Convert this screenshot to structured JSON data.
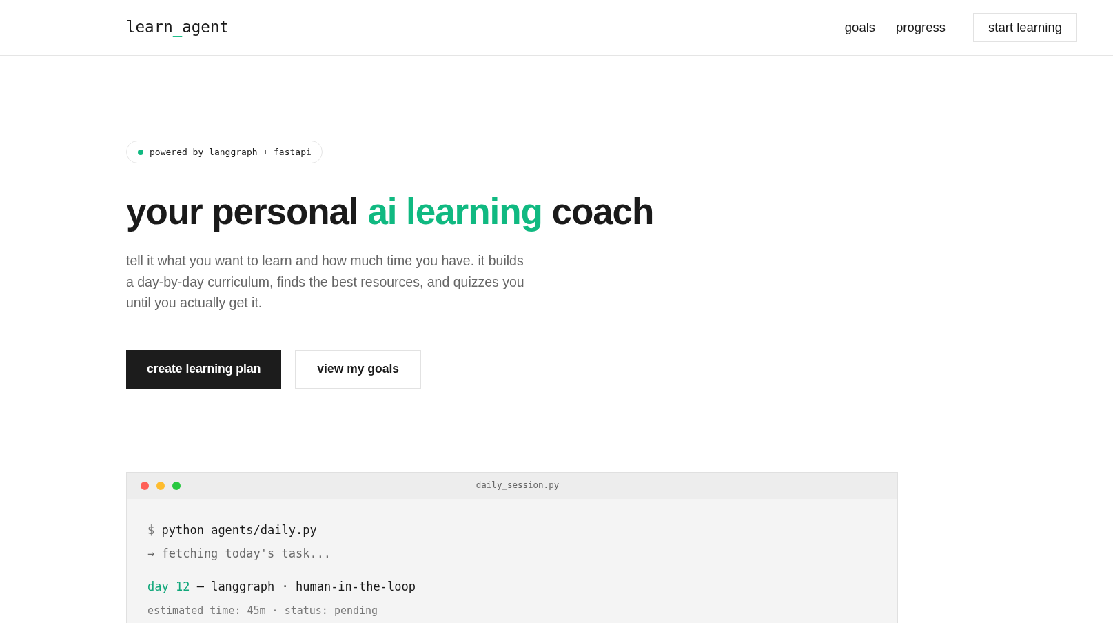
{
  "header": {
    "logo": [
      {
        "text": "learn",
        "accent": false
      },
      {
        "text": "_",
        "accent": true
      },
      {
        "text": "agent",
        "accent": false
      }
    ],
    "nav": [
      {
        "label": "goals"
      },
      {
        "label": "progress"
      }
    ],
    "cta": {
      "label": "start learning"
    }
  },
  "hero": {
    "badge": "powered by langgraph + fastapi",
    "title": [
      {
        "text": "your personal ",
        "accent": false
      },
      {
        "text": "ai learning",
        "accent": true
      },
      {
        "text": " coach",
        "accent": false
      }
    ],
    "description": "tell it what you want to learn and how much time you have. it builds a day-by-day curriculum, finds the best resources, and quizzes you until you actually get it.",
    "buttons": [
      {
        "label": "create learning plan",
        "kind": "primary"
      },
      {
        "label": "view my goals",
        "kind": "secondary"
      }
    ]
  },
  "terminal": {
    "window_controls": [
      {
        "color": "#ff5f57"
      },
      {
        "color": "#febc2e"
      },
      {
        "color": "#28c840"
      }
    ],
    "filename": "daily_session.py",
    "lines": [
      {
        "kind": "command",
        "prompt": "$",
        "text": "python agents/daily.py"
      },
      {
        "kind": "log",
        "text": "→ fetching today's task..."
      },
      {
        "kind": "heading",
        "label": "day 12",
        "text": "— langgraph · human-in-the-loop"
      },
      {
        "kind": "meta",
        "text": "estimated time: 45m · status: pending"
      }
    ]
  }
}
